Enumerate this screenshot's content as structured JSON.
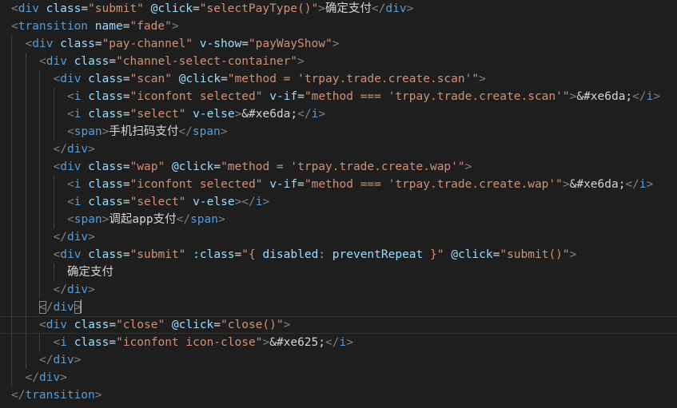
{
  "editor": {
    "colors": {
      "background": "#1e1e1e",
      "punctuation": "#808080",
      "tag": "#569cd6",
      "attribute": "#9cdcfe",
      "string": "#ce9178",
      "text": "#d4d4d4",
      "indent_guide": "#404040"
    },
    "active_line": 18,
    "lines": [
      {
        "indent": 0,
        "tokens": [
          [
            "punc",
            "<"
          ],
          [
            "tag",
            "div"
          ],
          [
            "sp",
            " "
          ],
          [
            "attr",
            "class"
          ],
          [
            "mid",
            "="
          ],
          [
            "str",
            "\"submit\""
          ],
          [
            "sp",
            " "
          ],
          [
            "attr",
            "@click"
          ],
          [
            "mid",
            "="
          ],
          [
            "str",
            "\"selectPayType()\""
          ],
          [
            "punc",
            ">"
          ],
          [
            "text",
            "确定支付"
          ],
          [
            "punc",
            "</"
          ],
          [
            "tag",
            "div"
          ],
          [
            "punc",
            ">"
          ]
        ]
      },
      {
        "indent": 0,
        "tokens": [
          [
            "punc",
            "<"
          ],
          [
            "tag",
            "transition"
          ],
          [
            "sp",
            " "
          ],
          [
            "attr",
            "name"
          ],
          [
            "mid",
            "="
          ],
          [
            "str",
            "\"fade\""
          ],
          [
            "punc",
            ">"
          ]
        ]
      },
      {
        "indent": 1,
        "tokens": [
          [
            "punc",
            "<"
          ],
          [
            "tag",
            "div"
          ],
          [
            "sp",
            " "
          ],
          [
            "attr",
            "class"
          ],
          [
            "mid",
            "="
          ],
          [
            "str",
            "\"pay-channel\""
          ],
          [
            "sp",
            " "
          ],
          [
            "attr",
            "v-show"
          ],
          [
            "mid",
            "="
          ],
          [
            "str",
            "\"payWayShow\""
          ],
          [
            "punc",
            ">"
          ]
        ]
      },
      {
        "indent": 2,
        "tokens": [
          [
            "punc",
            "<"
          ],
          [
            "tag",
            "div"
          ],
          [
            "sp",
            " "
          ],
          [
            "attr",
            "class"
          ],
          [
            "mid",
            "="
          ],
          [
            "str",
            "\"channel-select-container\""
          ],
          [
            "punc",
            ">"
          ]
        ]
      },
      {
        "indent": 3,
        "tokens": [
          [
            "punc",
            "<"
          ],
          [
            "tag",
            "div"
          ],
          [
            "sp",
            " "
          ],
          [
            "attr",
            "class"
          ],
          [
            "mid",
            "="
          ],
          [
            "str",
            "\"scan\""
          ],
          [
            "sp",
            " "
          ],
          [
            "attr",
            "@click"
          ],
          [
            "mid",
            "="
          ],
          [
            "str",
            "\"method = 'trpay.trade.create.scan'\""
          ],
          [
            "punc",
            ">"
          ]
        ]
      },
      {
        "indent": 4,
        "tokens": [
          [
            "punc",
            "<"
          ],
          [
            "tag",
            "i"
          ],
          [
            "sp",
            " "
          ],
          [
            "attr",
            "class"
          ],
          [
            "mid",
            "="
          ],
          [
            "str",
            "\"iconfont selected\""
          ],
          [
            "sp",
            " "
          ],
          [
            "attr",
            "v-if"
          ],
          [
            "mid",
            "="
          ],
          [
            "str",
            "\"method === 'trpay.trade.create.scan'\""
          ],
          [
            "punc",
            ">"
          ],
          [
            "text",
            "&#xe6da;"
          ],
          [
            "punc",
            "</"
          ],
          [
            "tag",
            "i"
          ],
          [
            "punc",
            ">"
          ]
        ]
      },
      {
        "indent": 4,
        "tokens": [
          [
            "punc",
            "<"
          ],
          [
            "tag",
            "i"
          ],
          [
            "sp",
            " "
          ],
          [
            "attr",
            "class"
          ],
          [
            "mid",
            "="
          ],
          [
            "str",
            "\"select\""
          ],
          [
            "sp",
            " "
          ],
          [
            "attr",
            "v-else"
          ],
          [
            "punc",
            ">"
          ],
          [
            "text",
            "&#xe6da;"
          ],
          [
            "punc",
            "</"
          ],
          [
            "tag",
            "i"
          ],
          [
            "punc",
            ">"
          ]
        ]
      },
      {
        "indent": 4,
        "tokens": [
          [
            "punc",
            "<"
          ],
          [
            "tag",
            "span"
          ],
          [
            "punc",
            ">"
          ],
          [
            "text",
            "手机扫码支付"
          ],
          [
            "punc",
            "</"
          ],
          [
            "tag",
            "span"
          ],
          [
            "punc",
            ">"
          ]
        ]
      },
      {
        "indent": 3,
        "tokens": [
          [
            "punc",
            "</"
          ],
          [
            "tag",
            "div"
          ],
          [
            "punc",
            ">"
          ]
        ]
      },
      {
        "indent": 3,
        "tokens": [
          [
            "punc",
            "<"
          ],
          [
            "tag",
            "div"
          ],
          [
            "sp",
            " "
          ],
          [
            "attr",
            "class"
          ],
          [
            "mid",
            "="
          ],
          [
            "str",
            "\"wap\""
          ],
          [
            "sp",
            " "
          ],
          [
            "attr",
            "@click"
          ],
          [
            "mid",
            "="
          ],
          [
            "str",
            "\"method = 'trpay.trade.create.wap'\""
          ],
          [
            "punc",
            ">"
          ]
        ]
      },
      {
        "indent": 4,
        "tokens": [
          [
            "punc",
            "<"
          ],
          [
            "tag",
            "i"
          ],
          [
            "sp",
            " "
          ],
          [
            "attr",
            "class"
          ],
          [
            "mid",
            "="
          ],
          [
            "str",
            "\"iconfont selected\""
          ],
          [
            "sp",
            " "
          ],
          [
            "attr",
            "v-if"
          ],
          [
            "mid",
            "="
          ],
          [
            "str",
            "\"method === 'trpay.trade.create.wap'\""
          ],
          [
            "punc",
            ">"
          ],
          [
            "text",
            "&#xe6da;"
          ],
          [
            "punc",
            "</"
          ],
          [
            "tag",
            "i"
          ],
          [
            "punc",
            ">"
          ]
        ]
      },
      {
        "indent": 4,
        "tokens": [
          [
            "punc",
            "<"
          ],
          [
            "tag",
            "i"
          ],
          [
            "sp",
            " "
          ],
          [
            "attr",
            "class"
          ],
          [
            "mid",
            "="
          ],
          [
            "str",
            "\"select\""
          ],
          [
            "sp",
            " "
          ],
          [
            "attr",
            "v-else"
          ],
          [
            "punc",
            "></"
          ],
          [
            "tag",
            "i"
          ],
          [
            "punc",
            ">"
          ]
        ]
      },
      {
        "indent": 4,
        "tokens": [
          [
            "punc",
            "<"
          ],
          [
            "tag",
            "span"
          ],
          [
            "punc",
            ">"
          ],
          [
            "text",
            "调起app支付"
          ],
          [
            "punc",
            "</"
          ],
          [
            "tag",
            "span"
          ],
          [
            "punc",
            ">"
          ]
        ]
      },
      {
        "indent": 3,
        "tokens": [
          [
            "punc",
            "</"
          ],
          [
            "tag",
            "div"
          ],
          [
            "punc",
            ">"
          ]
        ]
      },
      {
        "indent": 3,
        "tokens": [
          [
            "punc",
            "<"
          ],
          [
            "tag",
            "div"
          ],
          [
            "sp",
            " "
          ],
          [
            "attr",
            "class"
          ],
          [
            "mid",
            "="
          ],
          [
            "str",
            "\"submit\""
          ],
          [
            "sp",
            " "
          ],
          [
            "attr",
            ":class"
          ],
          [
            "mid",
            "="
          ],
          [
            "str",
            "\"{ "
          ],
          [
            "attr",
            "disabled"
          ],
          [
            "str",
            ": "
          ],
          [
            "attr",
            "preventRepeat"
          ],
          [
            "str",
            " }\""
          ],
          [
            "sp",
            " "
          ],
          [
            "attr",
            "@click"
          ],
          [
            "mid",
            "="
          ],
          [
            "str",
            "\"submit()\""
          ],
          [
            "punc",
            ">"
          ]
        ]
      },
      {
        "indent": 4,
        "tokens": [
          [
            "text",
            "确定支付"
          ]
        ]
      },
      {
        "indent": 3,
        "tokens": [
          [
            "punc",
            "</"
          ],
          [
            "tag",
            "div"
          ],
          [
            "punc",
            ">"
          ]
        ]
      },
      {
        "indent": 2,
        "tokens": [
          [
            "hl",
            "<"
          ],
          [
            "punc",
            "/"
          ],
          [
            "tag",
            "div"
          ],
          [
            "hl",
            ">"
          ],
          [
            "cursor",
            ""
          ]
        ]
      },
      {
        "indent": 2,
        "tokens": [
          [
            "punc",
            "<"
          ],
          [
            "tag",
            "div"
          ],
          [
            "sp",
            " "
          ],
          [
            "attr",
            "class"
          ],
          [
            "mid",
            "="
          ],
          [
            "str",
            "\"close\""
          ],
          [
            "sp",
            " "
          ],
          [
            "attr",
            "@click"
          ],
          [
            "mid",
            "="
          ],
          [
            "str",
            "\"close()\""
          ],
          [
            "punc",
            ">"
          ]
        ]
      },
      {
        "indent": 3,
        "tokens": [
          [
            "punc",
            "<"
          ],
          [
            "tag",
            "i"
          ],
          [
            "sp",
            " "
          ],
          [
            "attr",
            "class"
          ],
          [
            "mid",
            "="
          ],
          [
            "str",
            "\"iconfont icon-close\""
          ],
          [
            "punc",
            ">"
          ],
          [
            "text",
            "&#xe625;"
          ],
          [
            "punc",
            "</"
          ],
          [
            "tag",
            "i"
          ],
          [
            "punc",
            ">"
          ]
        ]
      },
      {
        "indent": 2,
        "tokens": [
          [
            "punc",
            "</"
          ],
          [
            "tag",
            "div"
          ],
          [
            "punc",
            ">"
          ]
        ]
      },
      {
        "indent": 1,
        "tokens": [
          [
            "punc",
            "</"
          ],
          [
            "tag",
            "div"
          ],
          [
            "punc",
            ">"
          ]
        ]
      },
      {
        "indent": 0,
        "tokens": [
          [
            "punc",
            "</"
          ],
          [
            "tag",
            "transition"
          ],
          [
            "punc",
            ">"
          ]
        ]
      }
    ]
  }
}
